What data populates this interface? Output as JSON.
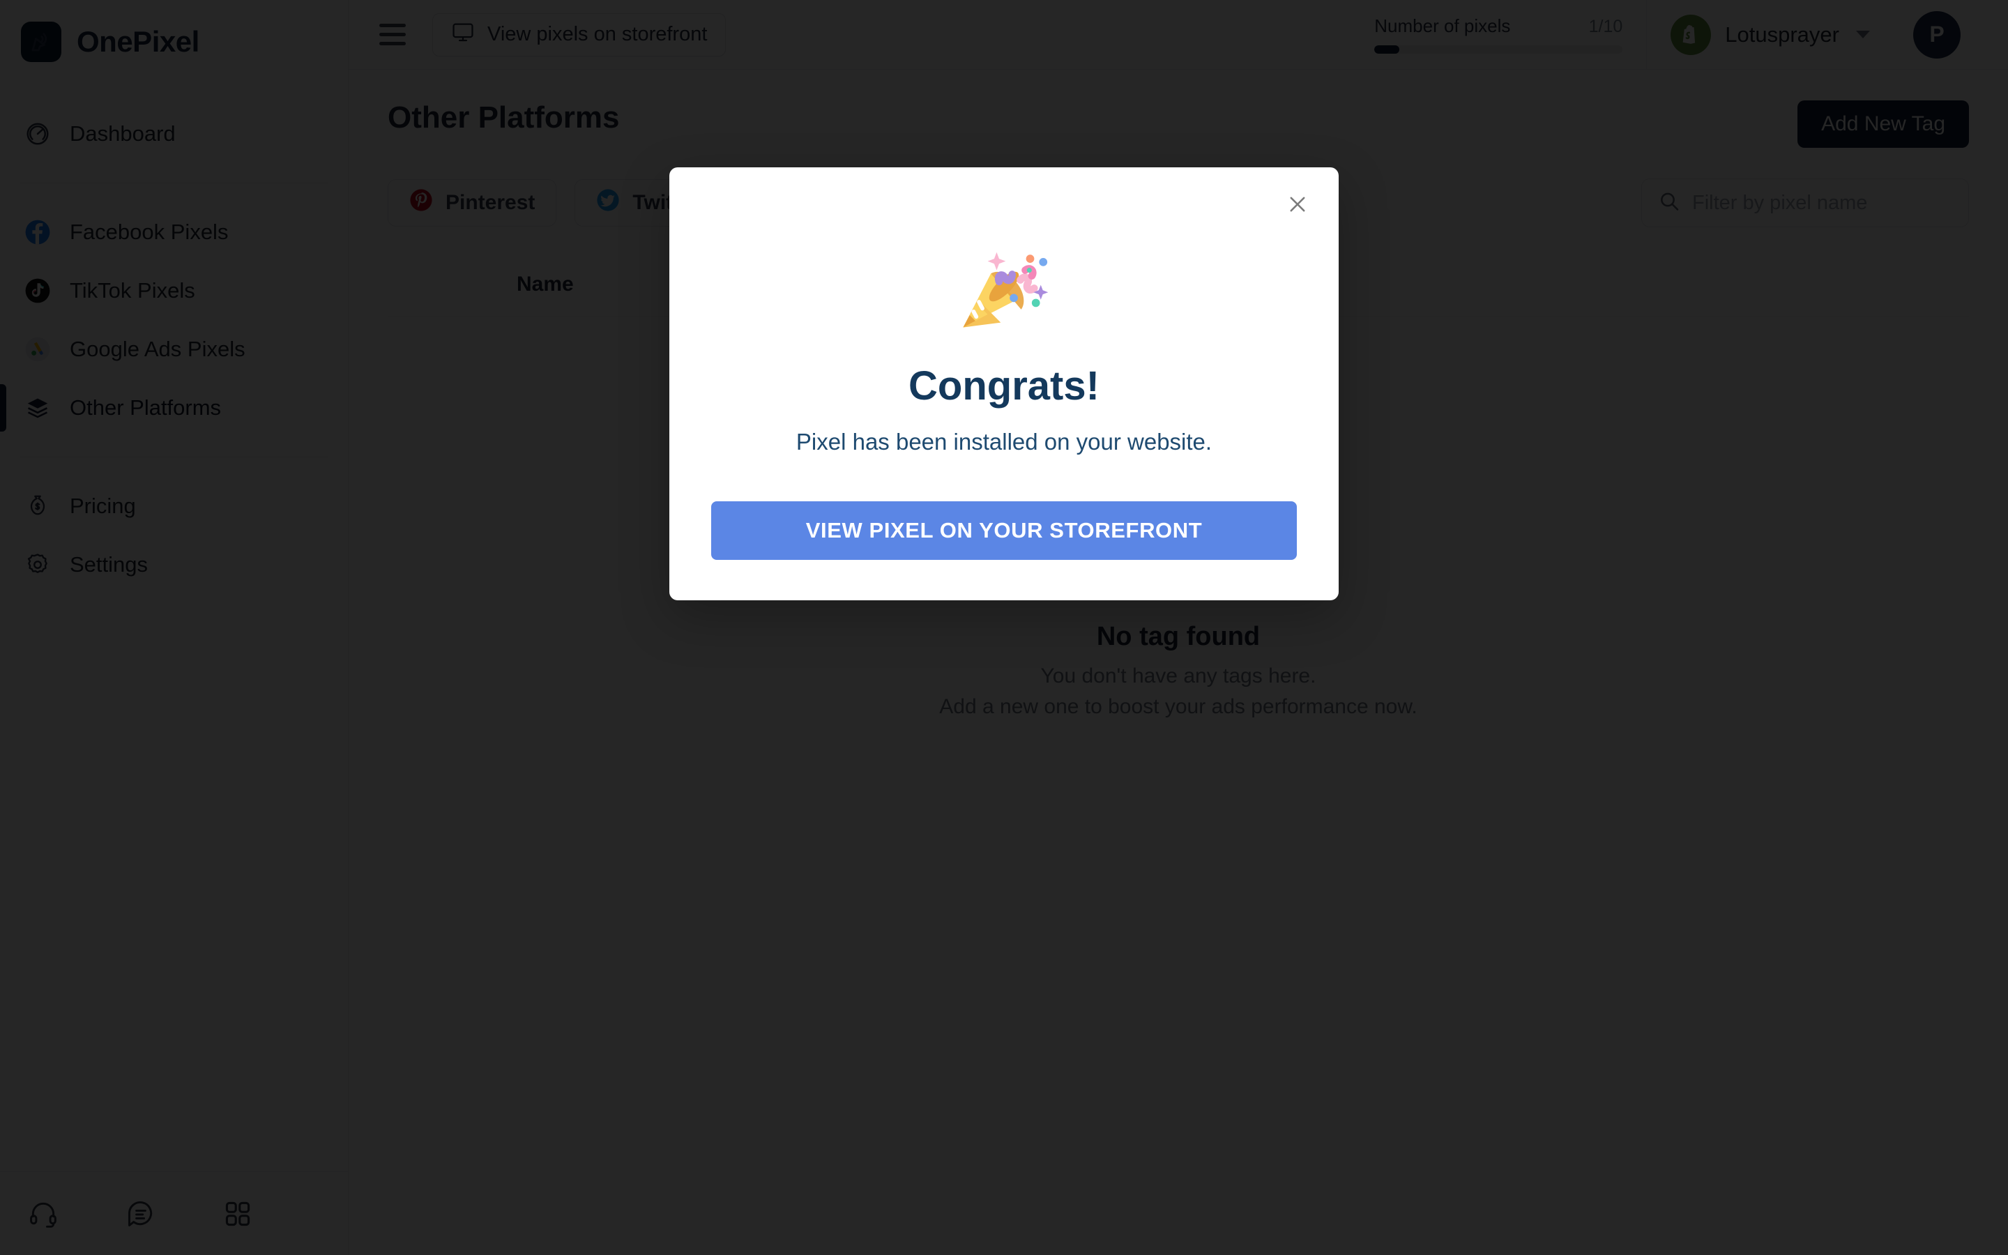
{
  "brand": {
    "name": "OnePixel",
    "logo_icon": "cursor-pixel-icon"
  },
  "sidebar": {
    "groups": [
      {
        "items": [
          {
            "label": "Dashboard",
            "icon": "dashboard-gauge-icon",
            "active": false
          }
        ]
      },
      {
        "items": [
          {
            "label": "Facebook Pixels",
            "icon": "facebook-icon",
            "active": false
          },
          {
            "label": "TikTok Pixels",
            "icon": "tiktok-icon",
            "active": false
          },
          {
            "label": "Google Ads Pixels",
            "icon": "google-ads-icon",
            "active": false
          },
          {
            "label": "Other Platforms",
            "icon": "layers-icon",
            "active": true
          }
        ]
      },
      {
        "items": [
          {
            "label": "Pricing",
            "icon": "money-bag-icon",
            "active": false
          },
          {
            "label": "Settings",
            "icon": "gear-icon",
            "active": false
          }
        ]
      }
    ],
    "footer_icons": [
      "headset-support-icon",
      "chat-message-icon",
      "apps-grid-icon"
    ]
  },
  "topbar": {
    "menu_icon": "hamburger-icon",
    "storefront_button": {
      "label": "View pixels on storefront",
      "icon": "monitor-icon"
    },
    "pixel_meter": {
      "label": "Number of pixels",
      "count": "1/10",
      "percent": 10
    },
    "shop": {
      "name": "Lotusprayer",
      "icon": "shopify-icon"
    },
    "user_avatar": {
      "initial": "P"
    }
  },
  "page": {
    "title": "Other Platforms",
    "add_button": "Add New Tag",
    "tabs": [
      {
        "label": "Pinterest",
        "icon": "pinterest-icon"
      },
      {
        "label": "Twitter",
        "icon": "twitter-icon"
      }
    ],
    "search": {
      "placeholder": "Filter by pixel name",
      "value": "",
      "icon": "search-icon"
    },
    "table": {
      "columns": [
        "Name"
      ]
    },
    "empty_state": {
      "title": "No tag found",
      "line1": "You don't have any tags here.",
      "line2": "Add a new one to boost your ads performance now."
    }
  },
  "modal": {
    "emoji": "party-popper-icon",
    "title": "Congrats!",
    "subtitle": "Pixel has been installed on your website.",
    "cta": "VIEW PIXEL ON YOUR STOREFRONT",
    "close_icon": "close-icon"
  },
  "colors": {
    "brand_navy": "#101c36",
    "cta_blue": "#5b86e5",
    "modal_title": "#14395c",
    "shopify_green": "#5e8e3e",
    "pinterest_red": "#bd081c",
    "twitter_blue": "#1d9bf0",
    "facebook_blue": "#1877f2"
  }
}
